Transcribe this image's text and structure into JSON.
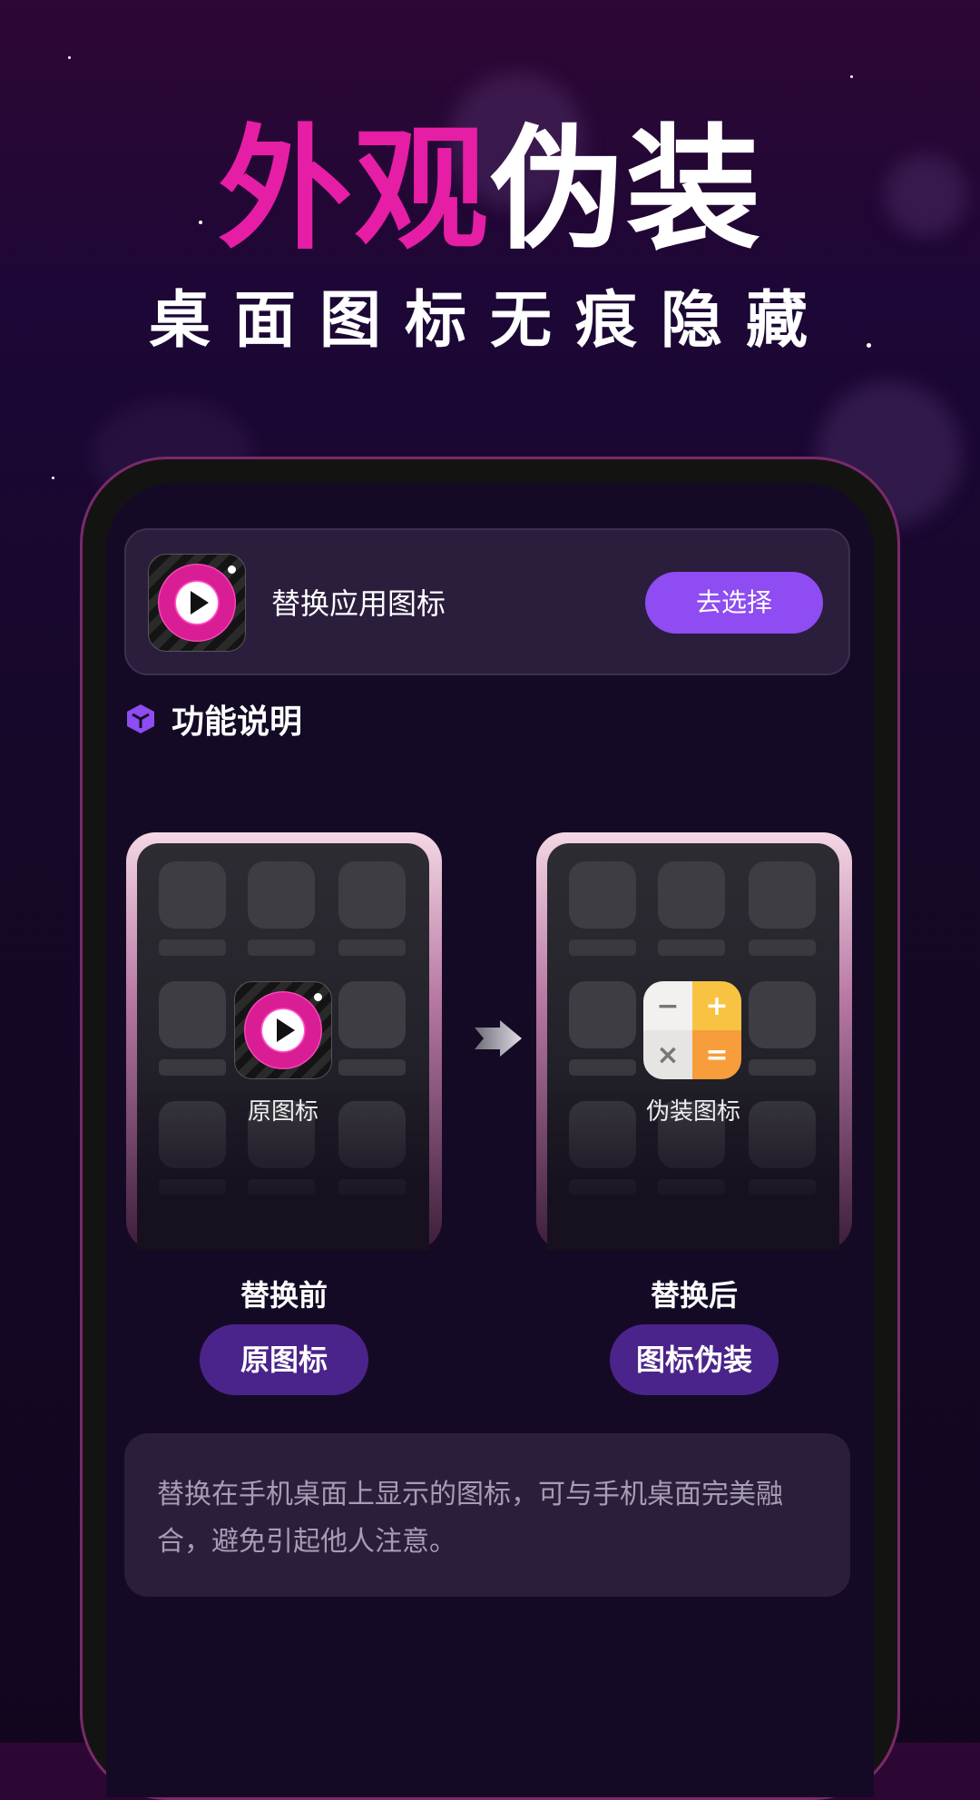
{
  "header": {
    "title_pink": "外观",
    "title_white": "伪装",
    "subtitle": "桌面图标无痕隐藏"
  },
  "card": {
    "label": "替换应用图标",
    "button": "去选择"
  },
  "section": {
    "title": "功能说明"
  },
  "before": {
    "icon_label": "原图标",
    "caption": "替换前",
    "button": "原图标"
  },
  "after": {
    "icon_label": "伪装图标",
    "caption": "替换后",
    "button": "图标伪装",
    "calc_keys": [
      "−",
      "+",
      "×",
      "="
    ]
  },
  "description": "替换在手机桌面上显示的图标，可与手机桌面完美融合，避免引起他人注意。",
  "colors": {
    "accent_pink": "#e61ea5",
    "accent_purple": "#8e4cf2",
    "pill_purple": "#4b248b"
  }
}
